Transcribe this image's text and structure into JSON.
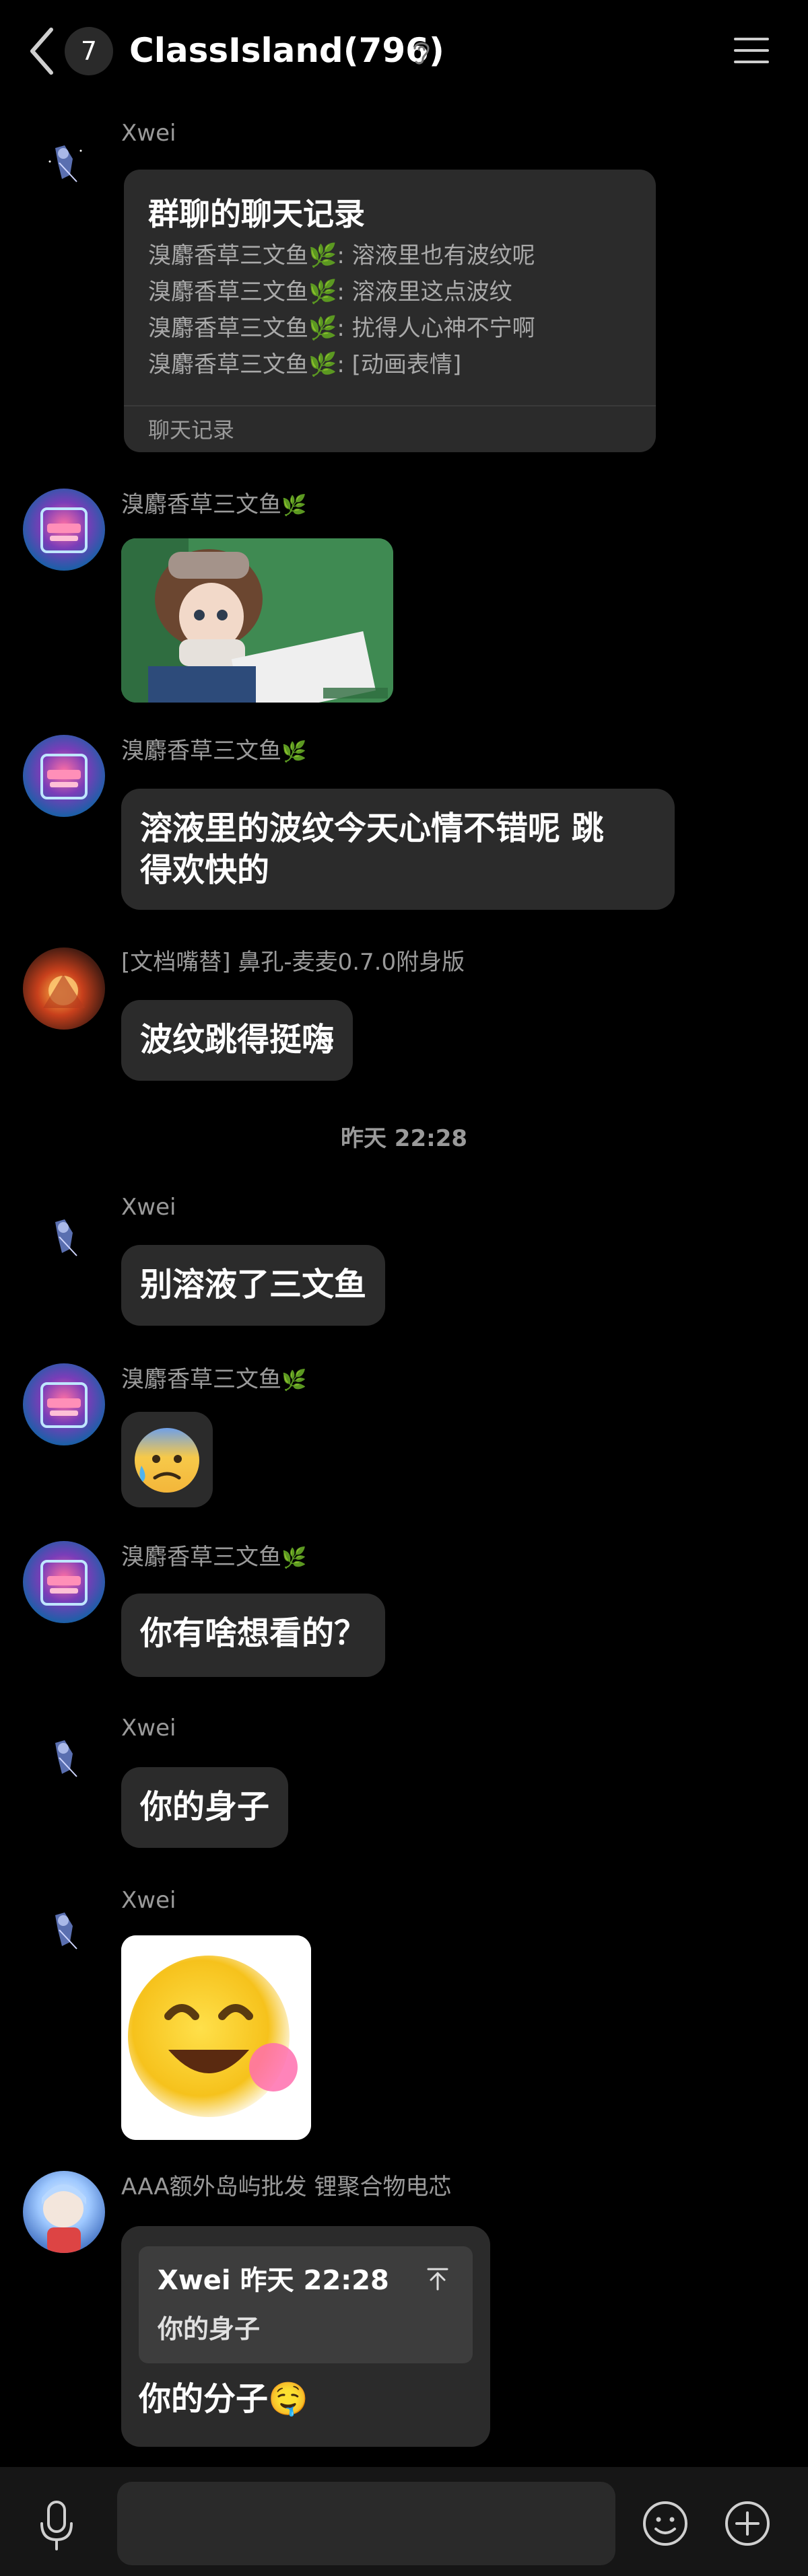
{
  "header": {
    "unread_count": "7",
    "title": "ClassIsland(796)"
  },
  "messages": [
    {
      "sender": "Xwei"
    },
    {
      "sender": "溴麝香草三文鱼"
    },
    {
      "sender": "溴麝香草三文鱼",
      "text_line1": "溶液里的波纹今天心情不错呢 跳",
      "text_line2": "得欢快的"
    },
    {
      "sender": "[文档嘴替] 鼻孔-麦麦0.7.0附身版",
      "text": "波纹跳得挺嗨"
    },
    {
      "sender": "Xwei",
      "text": "别溶液了三文鱼"
    },
    {
      "sender": "溴麝香草三文鱼"
    },
    {
      "sender": "溴麝香草三文鱼",
      "text": "你有啥想看的？"
    },
    {
      "sender": "Xwei",
      "text": "你的身子"
    },
    {
      "sender": "Xwei"
    },
    {
      "sender": "AAA额外岛屿批发 锂聚合物电芯",
      "text": "你的分子"
    }
  ],
  "forward_card": {
    "title": "群聊的聊天记录",
    "lines": [
      "溴麝香草三文鱼🌿: 溶液里也有波纹呢",
      "溴麝香草三文鱼🌿: 溶液里这点波纹",
      "溴麝香草三文鱼🌿: 扰得人心神不宁啊",
      "溴麝香草三文鱼🌿: [动画表情]"
    ],
    "footer": "聊天记录"
  },
  "time_separator": "昨天 22:28",
  "quote": {
    "header": "Xwei 昨天 22:28",
    "body": "你的身子"
  },
  "input": {
    "placeholder": ""
  },
  "emojis": {
    "anxious": "😰",
    "drool": "🤤",
    "leaf": "🌿"
  },
  "colors": {
    "background": "#000000",
    "bubble": "#2b2b2b",
    "secondary_text": "#9a9a9a",
    "leaf": "#6bbf3a"
  }
}
